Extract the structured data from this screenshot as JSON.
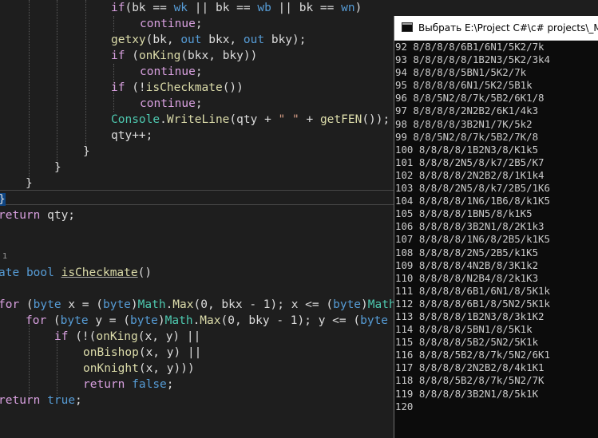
{
  "editor": {
    "lines": [
      {
        "segments": [
          {
            "t": "if",
            "c": "ctl"
          },
          {
            "t": "(bk == ",
            "c": ""
          },
          {
            "t": "wk",
            "c": "kw"
          },
          {
            "t": " || bk == ",
            "c": ""
          },
          {
            "t": "wb",
            "c": "kw"
          },
          {
            "t": " || bk == ",
            "c": ""
          },
          {
            "t": "wn",
            "c": "kw"
          },
          {
            "t": ")",
            "c": ""
          }
        ]
      },
      {
        "segments": [
          {
            "t": "continue",
            "c": "ctl"
          },
          {
            "t": ";",
            "c": ""
          }
        ]
      },
      {
        "segments": [
          {
            "t": "getxy",
            "c": "fn"
          },
          {
            "t": "(bk, ",
            "c": ""
          },
          {
            "t": "out",
            "c": "kw"
          },
          {
            "t": " bkx, ",
            "c": ""
          },
          {
            "t": "out",
            "c": "kw"
          },
          {
            "t": " bky);",
            "c": ""
          }
        ]
      },
      {
        "segments": [
          {
            "t": "if",
            "c": "ctl"
          },
          {
            "t": " (",
            "c": ""
          },
          {
            "t": "onKing",
            "c": "fn"
          },
          {
            "t": "(bkx, bky))",
            "c": ""
          }
        ]
      },
      {
        "segments": [
          {
            "t": "continue",
            "c": "ctl"
          },
          {
            "t": ";",
            "c": ""
          }
        ]
      },
      {
        "segments": [
          {
            "t": "if",
            "c": "ctl"
          },
          {
            "t": " (!",
            "c": ""
          },
          {
            "t": "isCheckmate",
            "c": "fn"
          },
          {
            "t": "())",
            "c": ""
          }
        ]
      },
      {
        "segments": [
          {
            "t": "continue",
            "c": "ctl"
          },
          {
            "t": ";",
            "c": ""
          }
        ]
      },
      {
        "segments": [
          {
            "t": "Console",
            "c": "ty"
          },
          {
            "t": ".",
            "c": ""
          },
          {
            "t": "WriteLine",
            "c": "fn"
          },
          {
            "t": "(qty + ",
            "c": ""
          },
          {
            "t": "\" \"",
            "c": "st"
          },
          {
            "t": " + ",
            "c": ""
          },
          {
            "t": "getFEN",
            "c": "fn"
          },
          {
            "t": "());",
            "c": ""
          }
        ]
      },
      {
        "segments": [
          {
            "t": "qty++;",
            "c": ""
          }
        ]
      },
      {
        "segments": [
          {
            "t": "}",
            "c": ""
          }
        ]
      },
      {
        "segments": [
          {
            "t": "}",
            "c": ""
          }
        ]
      },
      {
        "segments": [
          {
            "t": "}",
            "c": ""
          }
        ]
      },
      {
        "segments": [
          {
            "t": "}",
            "c": "brace"
          }
        ]
      },
      {
        "segments": [
          {
            "t": "return",
            "c": "ctl"
          },
          {
            "t": " qty;",
            "c": ""
          }
        ]
      },
      {
        "segments": []
      },
      {
        "segments": []
      },
      {
        "segments": [
          {
            "t": "ate",
            "c": "kw"
          },
          {
            "t": " ",
            "c": ""
          },
          {
            "t": "bool",
            "c": "kw"
          },
          {
            "t": " ",
            "c": ""
          },
          {
            "t": "isCheckmate",
            "c": "fn uline"
          },
          {
            "t": "()",
            "c": ""
          }
        ]
      },
      {
        "segments": []
      },
      {
        "segments": [
          {
            "t": "for",
            "c": "ctl"
          },
          {
            "t": " (",
            "c": ""
          },
          {
            "t": "byte",
            "c": "kw"
          },
          {
            "t": " x = (",
            "c": ""
          },
          {
            "t": "byte",
            "c": "kw"
          },
          {
            "t": ")",
            "c": ""
          },
          {
            "t": "Math",
            "c": "ty"
          },
          {
            "t": ".",
            "c": ""
          },
          {
            "t": "Max",
            "c": "fn"
          },
          {
            "t": "(0, bkx - 1); x <= (",
            "c": ""
          },
          {
            "t": "byte",
            "c": "kw"
          },
          {
            "t": ")",
            "c": ""
          },
          {
            "t": "Math",
            "c": "ty"
          }
        ]
      },
      {
        "segments": [
          {
            "t": "for",
            "c": "ctl"
          },
          {
            "t": " (",
            "c": ""
          },
          {
            "t": "byte",
            "c": "kw"
          },
          {
            "t": " y = (",
            "c": ""
          },
          {
            "t": "byte",
            "c": "kw"
          },
          {
            "t": ")",
            "c": ""
          },
          {
            "t": "Math",
            "c": "ty"
          },
          {
            "t": ".",
            "c": ""
          },
          {
            "t": "Max",
            "c": "fn"
          },
          {
            "t": "(0, bky - 1); y <= (",
            "c": ""
          },
          {
            "t": "byte",
            "c": "kw"
          }
        ]
      },
      {
        "segments": [
          {
            "t": "if",
            "c": "ctl"
          },
          {
            "t": " (!(",
            "c": ""
          },
          {
            "t": "onKing",
            "c": "fn"
          },
          {
            "t": "(x, y) ||",
            "c": ""
          }
        ]
      },
      {
        "segments": [
          {
            "t": "onBishop",
            "c": "fn"
          },
          {
            "t": "(x, y) ||",
            "c": ""
          }
        ]
      },
      {
        "segments": [
          {
            "t": "onKnight",
            "c": "fn"
          },
          {
            "t": "(x, y)))",
            "c": ""
          }
        ]
      },
      {
        "segments": [
          {
            "t": "return",
            "c": "ctl"
          },
          {
            "t": " ",
            "c": ""
          },
          {
            "t": "false",
            "c": "kw"
          },
          {
            "t": ";",
            "c": ""
          }
        ]
      },
      {
        "segments": [
          {
            "t": "return",
            "c": "ctl"
          },
          {
            "t": " ",
            "c": ""
          },
          {
            "t": "true",
            "c": "kw"
          },
          {
            "t": ";",
            "c": ""
          }
        ]
      }
    ],
    "codelens": "1"
  },
  "console": {
    "title": "Выбрать E:\\Project C#\\c# projects\\_MatKo",
    "lines": [
      "92 8/8/8/8/6B1/6N1/5K2/7k",
      "93 8/8/8/8/8/1B2N3/5K2/3k4",
      "94 8/8/8/8/5BN1/5K2/7k",
      "95 8/8/8/8/6N1/5K2/5B1k",
      "96 8/8/5N2/8/7k/5B2/6K1/8",
      "97 8/8/8/8/2N2B2/6K1/4k3",
      "98 8/8/8/8/3B2N1/7K/5k2",
      "99 8/8/5N2/8/7k/5B2/7K/8",
      "100 8/8/8/8/1B2N3/8/K1k5",
      "101 8/8/8/2N5/8/k7/2B5/K7",
      "102 8/8/8/8/2N2B2/8/1K1k4",
      "103 8/8/8/2N5/8/k7/2B5/1K6",
      "104 8/8/8/8/1N6/1B6/8/k1K5",
      "105 8/8/8/8/1BN5/8/k1K5",
      "106 8/8/8/8/3B2N1/8/2K1k3",
      "107 8/8/8/8/1N6/8/2B5/k1K5",
      "108 8/8/8/8/2N5/2B5/k1K5",
      "109 8/8/8/8/4N2B/8/3K1k2",
      "110 8/8/8/8/N2B4/8/2k1K3",
      "111 8/8/8/8/6B1/6N1/8/5K1k",
      "112 8/8/8/8/6B1/8/5N2/5K1k",
      "113 8/8/8/8/1B2N3/8/3k1K2",
      "114 8/8/8/8/5BN1/8/5K1k",
      "115 8/8/8/8/5B2/5N2/5K1k",
      "116 8/8/8/5B2/8/7k/5N2/6K1",
      "117 8/8/8/8/2N2B2/8/4k1K1",
      "118 8/8/8/5B2/8/7k/5N2/7K",
      "119 8/8/8/8/3B2N1/8/5k1K",
      "120"
    ]
  }
}
